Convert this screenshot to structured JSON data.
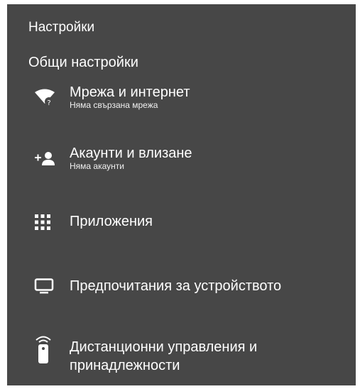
{
  "header": {
    "title": "Настройки"
  },
  "section": {
    "title": "Общи настройки"
  },
  "items": [
    {
      "icon": "wifi-question-icon",
      "label": "Мрежа и интернет",
      "sublabel": "Няма свързана мрежа"
    },
    {
      "icon": "add-account-icon",
      "label": "Акаунти и влизане",
      "sublabel": "Няма акаунти"
    },
    {
      "icon": "apps-grid-icon",
      "label": "Приложения"
    },
    {
      "icon": "tv-icon",
      "label": "Предпочитания за устройството"
    },
    {
      "icon": "remote-control-icon",
      "label": "Дистанционни управления и принадлежности"
    }
  ],
  "colors": {
    "panel_background": "#474747",
    "text": "#ffffff"
  }
}
